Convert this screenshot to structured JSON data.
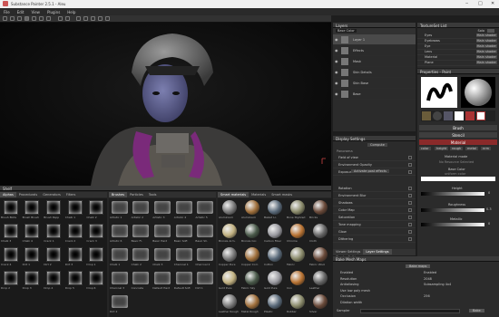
{
  "window": {
    "title": "Substance Painter 2.5.1 - Aleu"
  },
  "menu": [
    "File",
    "Edit",
    "View",
    "Plugins",
    "Help"
  ],
  "viewport": {
    "label": "Material"
  },
  "layers": {
    "title": "Layers",
    "blend": "Base Color",
    "items": [
      {
        "name": "Layer 1"
      },
      {
        "name": "Effects"
      },
      {
        "name": "Mask"
      },
      {
        "name": "Skin Details"
      },
      {
        "name": "Skin Base"
      },
      {
        "name": "Base"
      }
    ]
  },
  "texture_set": {
    "title": "TextureSet List",
    "solo_label": "Solo",
    "items": [
      {
        "name": "Eyes",
        "shader": "Main shader"
      },
      {
        "name": "Eyebrows",
        "shader": "Main shader"
      },
      {
        "name": "Eye",
        "shader": "Main shader"
      },
      {
        "name": "Lens",
        "shader": "Main shader"
      },
      {
        "name": "Material",
        "shader": "Main shader"
      },
      {
        "name": "Plane",
        "shader": "Main shader"
      }
    ]
  },
  "properties": {
    "title": "Properties - Paint",
    "sections": {
      "brush": "Brush",
      "stencil": "Stencil",
      "material": "Material"
    },
    "channels": [
      "color",
      "height",
      "rough",
      "metal",
      "nrm"
    ],
    "material_mode": "Material mode",
    "no_resource": "No Resource Selected",
    "base_color": "Base Color",
    "uniform_color": "uniform color",
    "height": "Height",
    "roughness": "Roughness",
    "metallic": "Metallic",
    "height_val": "0",
    "roughness_val": "0.3",
    "metallic_val": "0"
  },
  "display": {
    "title": "Display Settings",
    "preset_btn": "Compute",
    "env_map": "Panorama",
    "rows": [
      "Field of view",
      "Environment Opacity",
      "Exposure",
      "Rotation",
      "Environment Blur",
      "Shadows",
      "Color Map",
      "Saturation",
      "Tone mapping",
      "Glow",
      "Dithering"
    ],
    "activate_label": "Activate post effects",
    "tabs": [
      "Viewer Settings",
      "Layer Settings",
      "Shader Settings"
    ]
  },
  "shelf": {
    "title": "Shelf",
    "left_tabs": [
      "Alphas",
      "Procedurals",
      "Generators",
      "Filters"
    ],
    "mid_tabs": [
      "Brushes",
      "Particles",
      "Tools"
    ],
    "right_tabs": [
      "Smart materials",
      "Materials",
      "Smart masks"
    ],
    "alphas": [
      "Brush Blots",
      "Brush Brush",
      "Brush Pepp",
      "Chalk 1",
      "Chalk 2",
      "Chalk 3",
      "Chalk 4",
      "Crack 1",
      "Crack 2",
      "Crack 3",
      "Crack 4",
      "Dirt 1",
      "Dirt 2",
      "Dirt 3",
      "Drop 1",
      "Drop 2",
      "Drop 3",
      "Drop 4",
      "Drop 5",
      "Drop 6"
    ],
    "brushes": [
      "Artistic 1",
      "Artistic 2",
      "Artistic 3",
      "Artistic 4",
      "Artistic 5",
      "Artistic 6",
      "Basic Fl.",
      "Basic Hard",
      "Basic Soft",
      "Basic Sh.",
      "Chalk 1",
      "Chalk 2",
      "Chalk 3",
      "Charcoal 1",
      "Charcoal 2",
      "Charcoal 3",
      "Concrete",
      "Default Hard",
      "Default Soft",
      "Dirt 1",
      "Dirt 2"
    ],
    "materials": [
      "Aluminium",
      "Aluminium",
      "Baked Li.",
      "Bone Stylized",
      "Bricks",
      "Bronze Arm.",
      "Bronze Cor.",
      "Carbon Fiber",
      "Chrome",
      "Cloth",
      "Copper Pure",
      "Copper Corr.",
      "Cotton",
      "Fabric",
      "Fabric Wool",
      "Gold Pure",
      "Fabric Sky",
      "Gold Pure",
      "Iron",
      "Leather",
      "Leather Rough",
      "Metal Rough",
      "Plastic",
      "Rubber",
      "Silver"
    ]
  },
  "bake": {
    "title": "Bake Mesh Maps",
    "tabs": [
      "Viewer Settings",
      "Layer Settings",
      "Shader Settings"
    ],
    "button": "Bake maps",
    "rows": [
      "Enabled",
      "Resolution",
      "Antialiasing",
      "Use low poly mesh",
      "Occlusion",
      "Dilation width"
    ],
    "values": [
      "Enabled",
      "2048",
      "Subsampling 4x4",
      "",
      "256",
      ""
    ],
    "bottom_label": "Sampler",
    "bottom_btn": "Bake"
  }
}
